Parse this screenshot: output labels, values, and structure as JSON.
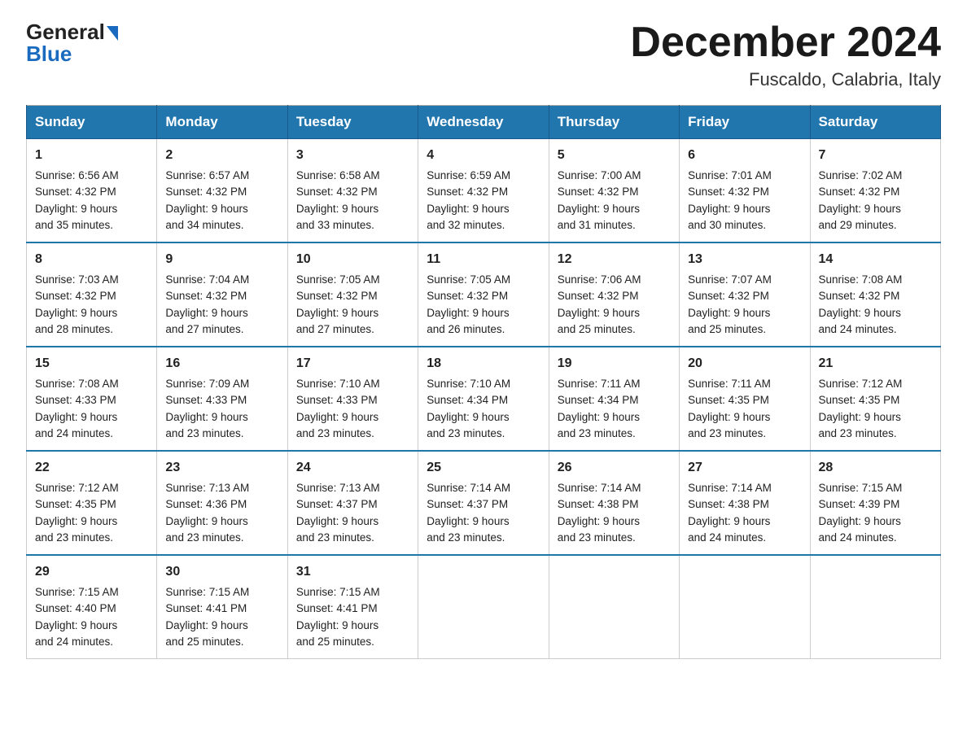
{
  "header": {
    "logo_general": "General",
    "logo_blue": "Blue",
    "month_title": "December 2024",
    "subtitle": "Fuscaldo, Calabria, Italy"
  },
  "days_of_week": [
    "Sunday",
    "Monday",
    "Tuesday",
    "Wednesday",
    "Thursday",
    "Friday",
    "Saturday"
  ],
  "weeks": [
    [
      {
        "day": "1",
        "sunrise": "6:56 AM",
        "sunset": "4:32 PM",
        "daylight": "9 hours and 35 minutes."
      },
      {
        "day": "2",
        "sunrise": "6:57 AM",
        "sunset": "4:32 PM",
        "daylight": "9 hours and 34 minutes."
      },
      {
        "day": "3",
        "sunrise": "6:58 AM",
        "sunset": "4:32 PM",
        "daylight": "9 hours and 33 minutes."
      },
      {
        "day": "4",
        "sunrise": "6:59 AM",
        "sunset": "4:32 PM",
        "daylight": "9 hours and 32 minutes."
      },
      {
        "day": "5",
        "sunrise": "7:00 AM",
        "sunset": "4:32 PM",
        "daylight": "9 hours and 31 minutes."
      },
      {
        "day": "6",
        "sunrise": "7:01 AM",
        "sunset": "4:32 PM",
        "daylight": "9 hours and 30 minutes."
      },
      {
        "day": "7",
        "sunrise": "7:02 AM",
        "sunset": "4:32 PM",
        "daylight": "9 hours and 29 minutes."
      }
    ],
    [
      {
        "day": "8",
        "sunrise": "7:03 AM",
        "sunset": "4:32 PM",
        "daylight": "9 hours and 28 minutes."
      },
      {
        "day": "9",
        "sunrise": "7:04 AM",
        "sunset": "4:32 PM",
        "daylight": "9 hours and 27 minutes."
      },
      {
        "day": "10",
        "sunrise": "7:05 AM",
        "sunset": "4:32 PM",
        "daylight": "9 hours and 27 minutes."
      },
      {
        "day": "11",
        "sunrise": "7:05 AM",
        "sunset": "4:32 PM",
        "daylight": "9 hours and 26 minutes."
      },
      {
        "day": "12",
        "sunrise": "7:06 AM",
        "sunset": "4:32 PM",
        "daylight": "9 hours and 25 minutes."
      },
      {
        "day": "13",
        "sunrise": "7:07 AM",
        "sunset": "4:32 PM",
        "daylight": "9 hours and 25 minutes."
      },
      {
        "day": "14",
        "sunrise": "7:08 AM",
        "sunset": "4:32 PM",
        "daylight": "9 hours and 24 minutes."
      }
    ],
    [
      {
        "day": "15",
        "sunrise": "7:08 AM",
        "sunset": "4:33 PM",
        "daylight": "9 hours and 24 minutes."
      },
      {
        "day": "16",
        "sunrise": "7:09 AM",
        "sunset": "4:33 PM",
        "daylight": "9 hours and 23 minutes."
      },
      {
        "day": "17",
        "sunrise": "7:10 AM",
        "sunset": "4:33 PM",
        "daylight": "9 hours and 23 minutes."
      },
      {
        "day": "18",
        "sunrise": "7:10 AM",
        "sunset": "4:34 PM",
        "daylight": "9 hours and 23 minutes."
      },
      {
        "day": "19",
        "sunrise": "7:11 AM",
        "sunset": "4:34 PM",
        "daylight": "9 hours and 23 minutes."
      },
      {
        "day": "20",
        "sunrise": "7:11 AM",
        "sunset": "4:35 PM",
        "daylight": "9 hours and 23 minutes."
      },
      {
        "day": "21",
        "sunrise": "7:12 AM",
        "sunset": "4:35 PM",
        "daylight": "9 hours and 23 minutes."
      }
    ],
    [
      {
        "day": "22",
        "sunrise": "7:12 AM",
        "sunset": "4:35 PM",
        "daylight": "9 hours and 23 minutes."
      },
      {
        "day": "23",
        "sunrise": "7:13 AM",
        "sunset": "4:36 PM",
        "daylight": "9 hours and 23 minutes."
      },
      {
        "day": "24",
        "sunrise": "7:13 AM",
        "sunset": "4:37 PM",
        "daylight": "9 hours and 23 minutes."
      },
      {
        "day": "25",
        "sunrise": "7:14 AM",
        "sunset": "4:37 PM",
        "daylight": "9 hours and 23 minutes."
      },
      {
        "day": "26",
        "sunrise": "7:14 AM",
        "sunset": "4:38 PM",
        "daylight": "9 hours and 23 minutes."
      },
      {
        "day": "27",
        "sunrise": "7:14 AM",
        "sunset": "4:38 PM",
        "daylight": "9 hours and 24 minutes."
      },
      {
        "day": "28",
        "sunrise": "7:15 AM",
        "sunset": "4:39 PM",
        "daylight": "9 hours and 24 minutes."
      }
    ],
    [
      {
        "day": "29",
        "sunrise": "7:15 AM",
        "sunset": "4:40 PM",
        "daylight": "9 hours and 24 minutes."
      },
      {
        "day": "30",
        "sunrise": "7:15 AM",
        "sunset": "4:41 PM",
        "daylight": "9 hours and 25 minutes."
      },
      {
        "day": "31",
        "sunrise": "7:15 AM",
        "sunset": "4:41 PM",
        "daylight": "9 hours and 25 minutes."
      },
      null,
      null,
      null,
      null
    ]
  ],
  "labels": {
    "sunrise": "Sunrise:",
    "sunset": "Sunset:",
    "daylight": "Daylight:"
  }
}
